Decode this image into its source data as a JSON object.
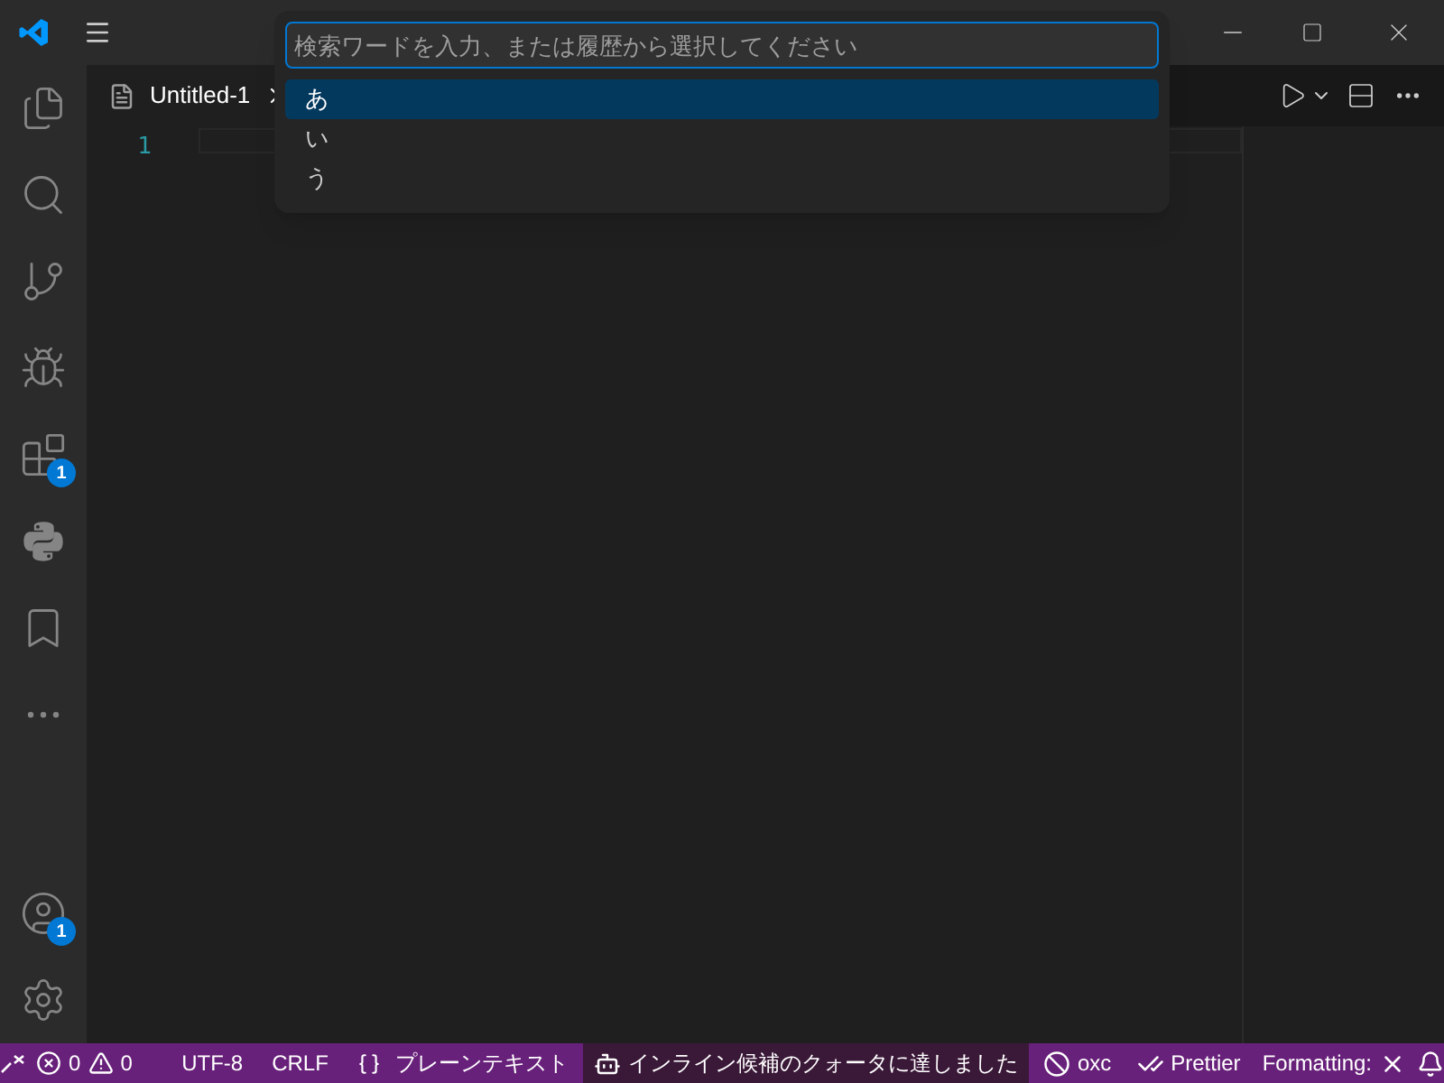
{
  "activity_bar": [
    {
      "kind": "files",
      "selected": false
    },
    {
      "kind": "search",
      "selected": false
    },
    {
      "kind": "scm",
      "selected": false
    },
    {
      "kind": "debug",
      "selected": false
    },
    {
      "kind": "extensions",
      "selected": false,
      "badge": "1"
    },
    {
      "kind": "python",
      "selected": false
    },
    {
      "kind": "bookmark",
      "selected": false
    },
    {
      "kind": "more",
      "selected": false
    }
  ],
  "activity_bottom": [
    {
      "kind": "account",
      "badge": "1"
    },
    {
      "kind": "settings"
    }
  ],
  "tab": {
    "label": "Untitled-1",
    "selected": true
  },
  "editor": {
    "line_numbers": [
      "1"
    ]
  },
  "quick_pick": {
    "placeholder": "検索ワードを入力、または履歴から選択してください",
    "items": [
      {
        "label": "あ",
        "selected": true
      },
      {
        "label": "い",
        "selected": false
      },
      {
        "label": "う",
        "selected": false
      }
    ]
  },
  "status_bar": [
    {
      "kind": "remote"
    },
    {
      "kind": "problems",
      "errors": "0",
      "warnings": "0"
    },
    {
      "kind": "text",
      "label": "UTF-8"
    },
    {
      "kind": "text",
      "label": "CRLF"
    },
    {
      "kind": "language",
      "label": "プレーンテキスト"
    },
    {
      "kind": "warning",
      "label": "インライン候補のクォータに達しました"
    },
    {
      "kind": "oxc",
      "label": "oxc"
    },
    {
      "kind": "prettier",
      "label": "Prettier"
    },
    {
      "kind": "formatting",
      "label": "Formatting:"
    },
    {
      "kind": "bell"
    }
  ]
}
